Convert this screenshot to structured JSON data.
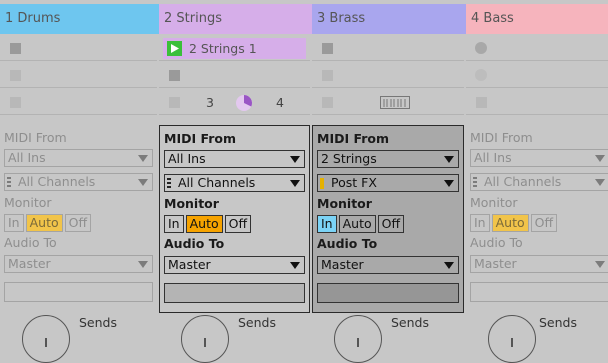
{
  "tracks": [
    {
      "name": "1 Drums",
      "color": "#6ec6ef"
    },
    {
      "name": "2 Strings",
      "color": "#d6aee9",
      "clip": "2 Strings 1",
      "clip_color": "#d6aee9",
      "stop_left": "3",
      "stop_right": "4"
    },
    {
      "name": "3 Brass",
      "color": "#a9a6ee"
    },
    {
      "name": "4 Bass",
      "color": "#f6b4bd"
    }
  ],
  "labels": {
    "midi_from": "MIDI From",
    "monitor": "Monitor",
    "audio_to": "Audio To",
    "sends": "Sends"
  },
  "io": [
    {
      "from": "All Ins",
      "channel": "All Channels",
      "in": "In",
      "auto": "Auto",
      "off": "Off",
      "to": "Master"
    },
    {
      "from": "All Ins",
      "channel": "All Channels",
      "in": "In",
      "auto": "Auto",
      "off": "Off",
      "to": "Master"
    },
    {
      "from": "2 Strings",
      "channel": "Post FX",
      "in": "In",
      "auto": "Auto",
      "off": "Off",
      "to": "Master"
    },
    {
      "from": "All Ins",
      "channel": "All Channels",
      "in": "In",
      "auto": "Auto",
      "off": "Off",
      "to": "Master"
    }
  ]
}
